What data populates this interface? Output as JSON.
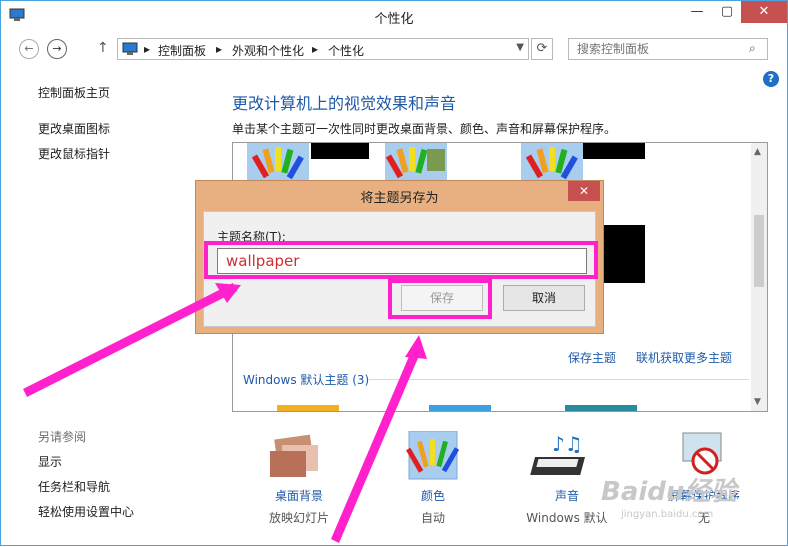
{
  "window": {
    "title": "个性化"
  },
  "navbar": {
    "breadcrumb": [
      "控制面板",
      "外观和个性化",
      "个性化"
    ],
    "search_placeholder": "搜索控制面板"
  },
  "sidebar": {
    "items": [
      "控制面板主页",
      "更改桌面图标",
      "更改鼠标指针"
    ],
    "see_also_title": "另请参阅",
    "see_also": [
      "显示",
      "任务栏和导航",
      "轻松使用设置中心"
    ]
  },
  "main": {
    "heading": "更改计算机上的视觉效果和声音",
    "subtext": "单击某个主题可一次性同时更改桌面背景、颜色、声音和屏幕保护程序。",
    "save_theme_link": "保存主题",
    "get_more_link": "联机获取更多主题",
    "group_title": "Windows 默认主题 (3)"
  },
  "bottom": [
    {
      "label": "桌面背景",
      "sub": "放映幻灯片"
    },
    {
      "label": "颜色",
      "sub": "自动"
    },
    {
      "label": "声音",
      "sub": "Windows 默认"
    },
    {
      "label": "屏幕保护程序",
      "sub": "无"
    }
  ],
  "dialog": {
    "title": "将主题另存为",
    "field_label": "主题名称(T):",
    "field_value": "wallpaper",
    "save_label": "保存",
    "cancel_label": "取消"
  },
  "watermark": {
    "text": "Baidu经验",
    "url": "jingyan.baidu.com"
  },
  "colors": {
    "annotation": "#ff22cc",
    "link": "#1e5aa8",
    "accent": "#4aa3df"
  }
}
